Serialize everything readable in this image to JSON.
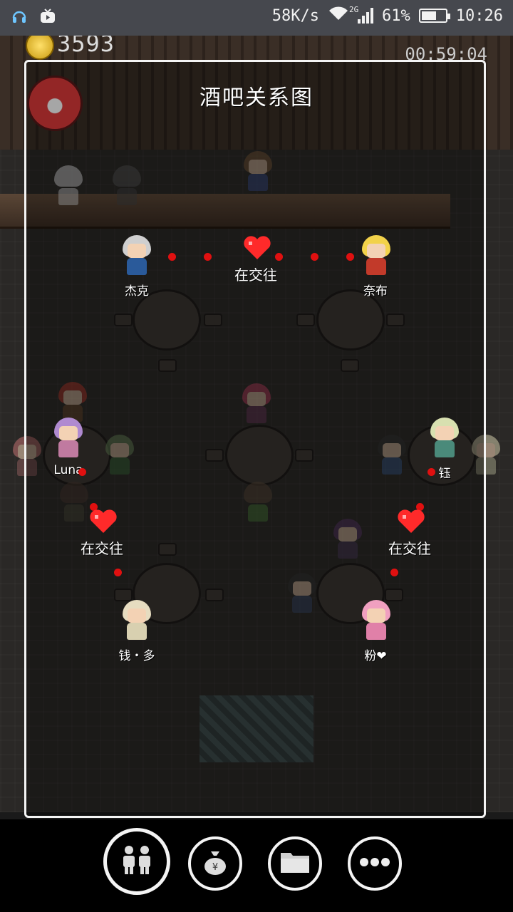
{
  "status_bar": {
    "net_speed": "58K/s",
    "signal_type": "2G",
    "battery_percent": "61%",
    "battery_level": 0.61,
    "time": "10:26",
    "icons": [
      "headset-icon",
      "tv-icon",
      "wifi-icon",
      "signal-icon",
      "battery-icon"
    ]
  },
  "hud": {
    "coin_count": "3593",
    "timer": "00:59:04",
    "weibo_label": "weibo-icon"
  },
  "panel": {
    "title": "酒吧关系图"
  },
  "characters": [
    {
      "id": "jack",
      "name": "杰克"
    },
    {
      "id": "naibu",
      "name": "奈布"
    },
    {
      "id": "luna",
      "name": "Luna"
    },
    {
      "id": "wang",
      "name": "钰"
    },
    {
      "id": "qianduo",
      "name": "钱・多"
    },
    {
      "id": "fen",
      "name": "粉❤"
    }
  ],
  "relations": [
    {
      "from": "jack",
      "to": "naibu",
      "label": "在交往"
    },
    {
      "from": "luna",
      "to": "qianduo",
      "label": "在交往"
    },
    {
      "from": "wang",
      "to": "fen",
      "label": "在交往"
    }
  ],
  "colors": {
    "heart": "#ff2a2a",
    "dot": "#e01010",
    "panel_border": "#f4f4f4",
    "status_bar": "#46484e"
  },
  "toolbar": {
    "buttons": [
      {
        "id": "relations",
        "icon": "people-icon",
        "active": true
      },
      {
        "id": "money",
        "icon": "money-bag-icon",
        "active": false
      },
      {
        "id": "folder",
        "icon": "folder-icon",
        "active": false
      },
      {
        "id": "more",
        "icon": "more-icon",
        "active": false
      }
    ]
  }
}
